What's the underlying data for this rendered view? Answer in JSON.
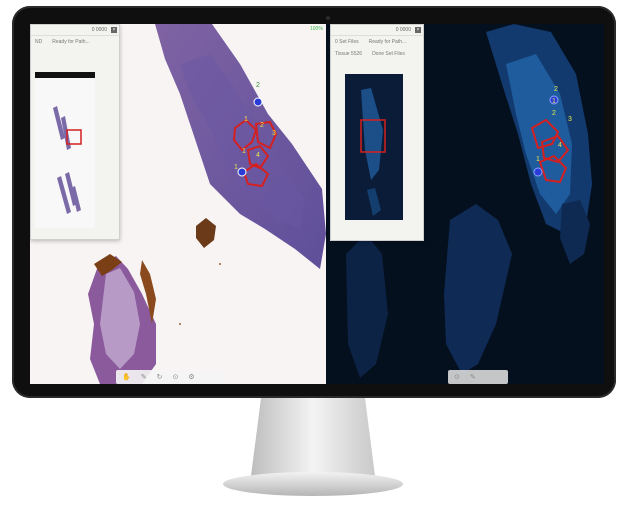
{
  "left_panel": {
    "controls": "0 0000",
    "status": "Ready for Path...",
    "left_label": "ND"
  },
  "right_panel": {
    "controls": "0 0000",
    "row1_left": "0 Set Files",
    "row1_right": "Ready for Path...",
    "row2_left": "Tissue 5526",
    "row2_right": "Done Set Files"
  },
  "status_percent": "100%",
  "annotations": {
    "left": [
      "2",
      "1",
      "2",
      "3",
      "1",
      "4",
      "1"
    ],
    "right": [
      "2",
      "1",
      "2",
      "3",
      "4",
      "1"
    ]
  },
  "colors": {
    "he_stain": "#8f6fad",
    "fluor_bg": "#05101f",
    "fluor_tissue": "#1e5c9e",
    "roi": "#d42020",
    "marker_blue": "#2a3cd8",
    "label_yellow": "#e8e84a"
  }
}
